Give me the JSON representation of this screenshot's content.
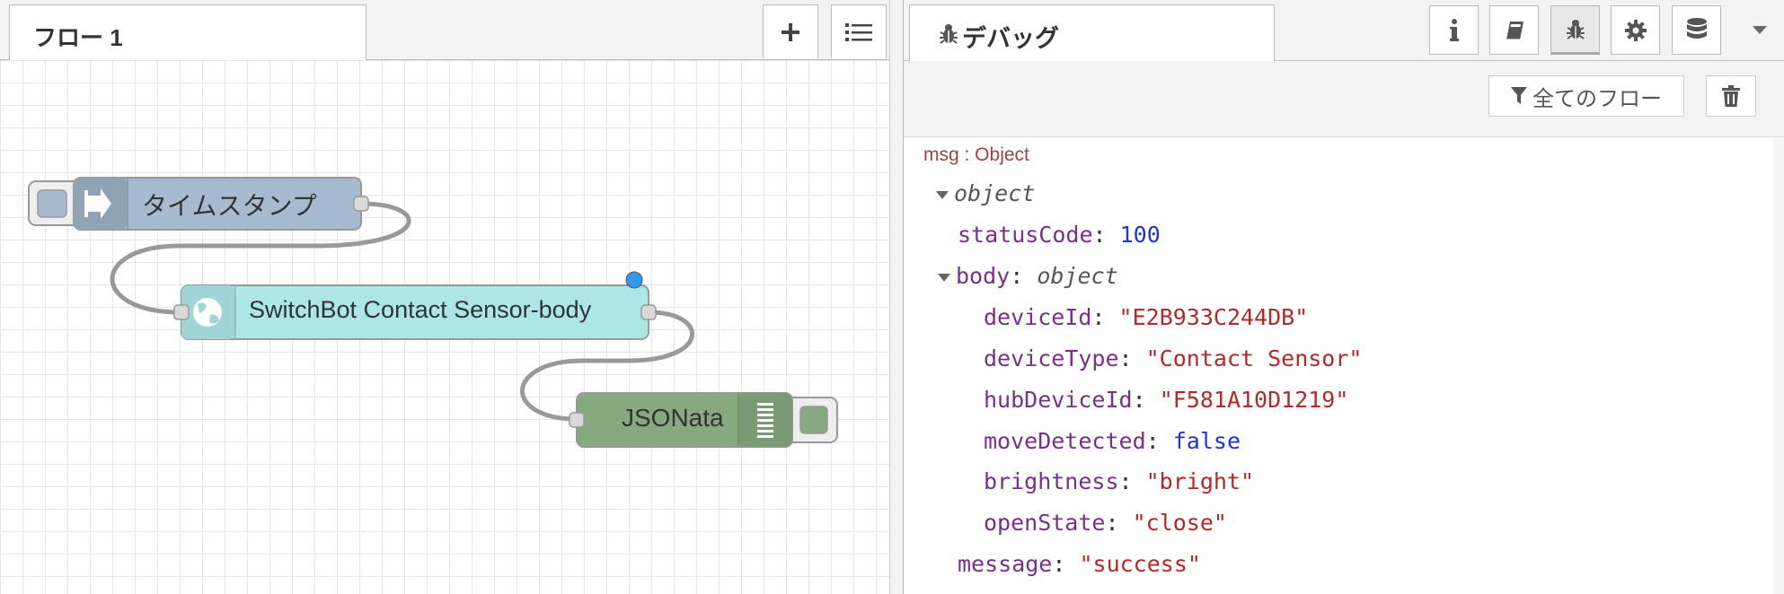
{
  "workspace": {
    "flow_tab_label": "フロー 1",
    "add_icon": "plus-icon",
    "menu_icon": "list-icon",
    "nodes": {
      "inject": {
        "label": "タイムスタンプ",
        "color": "#a6bbcf",
        "icon": "arrow-in-icon"
      },
      "http": {
        "label": "SwitchBot Contact Sensor-body",
        "color": "#ace6e6",
        "icon": "globe-icon"
      },
      "jsonata": {
        "label": "JSONata",
        "color": "#87a980",
        "icon": "lines-icon"
      }
    }
  },
  "sidebar": {
    "tab_label": "デバッグ",
    "tab_icon": "bug-icon",
    "buttons": [
      "info-icon",
      "book-icon",
      "bug-icon",
      "gear-icon",
      "database-icon",
      "caret-down-icon"
    ],
    "filter_label": "全てのフロー",
    "clear_icon": "trash-icon",
    "message": {
      "meta": "msg : Object",
      "root_type": "object",
      "statusCode_key": "statusCode",
      "statusCode_value": "100",
      "body_key": "body",
      "body_type": "object",
      "fields": [
        {
          "key": "deviceId",
          "value": "\"E2B933C244DB\"",
          "kind": "str"
        },
        {
          "key": "deviceType",
          "value": "\"Contact Sensor\"",
          "kind": "str"
        },
        {
          "key": "hubDeviceId",
          "value": "\"F581A10D1219\"",
          "kind": "str"
        },
        {
          "key": "moveDetected",
          "value": "false",
          "kind": "bool"
        },
        {
          "key": "brightness",
          "value": "\"bright\"",
          "kind": "str"
        },
        {
          "key": "openState",
          "value": "\"close\"",
          "kind": "str"
        }
      ],
      "message_key": "message",
      "message_value": "\"success\""
    }
  }
}
